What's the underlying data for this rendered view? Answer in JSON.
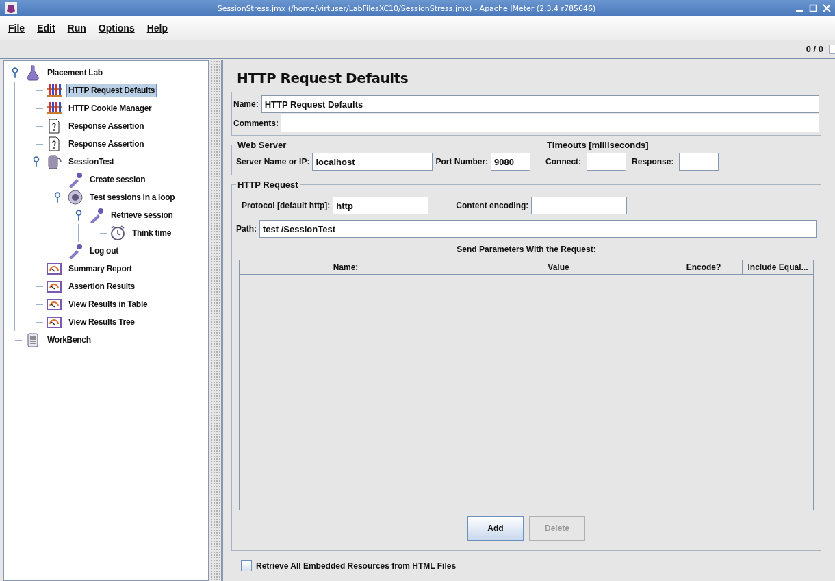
{
  "window": {
    "title": "SessionStress.jmx (/home/virtuser/LabFilesXC10/SessionStress.jmx) - Apache JMeter (2.3.4 r785646)"
  },
  "menu": [
    {
      "label": "File"
    },
    {
      "label": "Edit"
    },
    {
      "label": "Run"
    },
    {
      "label": "Options"
    },
    {
      "label": "Help"
    }
  ],
  "toolbar": {
    "counter": "0 / 0"
  },
  "tree": [
    {
      "label": "Placement Lab",
      "kind": "test_plan",
      "selected": false,
      "expanded": true,
      "children": [
        {
          "label": "HTTP Request Defaults",
          "kind": "config",
          "selected": true
        },
        {
          "label": "HTTP Cookie Manager",
          "kind": "config",
          "selected": false
        },
        {
          "label": "Response Assertion",
          "kind": "assertion",
          "selected": false
        },
        {
          "label": "Response Assertion",
          "kind": "assertion",
          "selected": false
        },
        {
          "label": "SessionTest",
          "kind": "thread_group",
          "selected": false,
          "expanded": true,
          "children": [
            {
              "label": "Create session",
              "kind": "sampler",
              "selected": false
            },
            {
              "label": "Test sessions in a loop",
              "kind": "loop",
              "selected": false,
              "expanded": true,
              "children": [
                {
                  "label": "Retrieve session",
                  "kind": "sampler",
                  "selected": false,
                  "expanded": true,
                  "children": [
                    {
                      "label": "Think time",
                      "kind": "timer",
                      "selected": false
                    }
                  ]
                }
              ]
            },
            {
              "label": "Log out",
              "kind": "sampler",
              "selected": false
            }
          ]
        },
        {
          "label": "Summary Report",
          "kind": "listener",
          "selected": false
        },
        {
          "label": "Assertion Results",
          "kind": "listener",
          "selected": false
        },
        {
          "label": "View Results in Table",
          "kind": "listener",
          "selected": false
        },
        {
          "label": "View Results Tree",
          "kind": "listener",
          "selected": false
        }
      ]
    },
    {
      "label": "WorkBench",
      "kind": "workbench",
      "selected": false
    }
  ],
  "panel": {
    "heading": "HTTP Request Defaults",
    "name": {
      "label": "Name:",
      "value": "HTTP Request Defaults"
    },
    "comments": {
      "label": "Comments:"
    },
    "web_server": {
      "title": "Web Server",
      "fields": [
        {
          "label": "Server Name or IP:",
          "value": "localhost"
        },
        {
          "label": "Port Number:",
          "value": "9080"
        }
      ]
    },
    "timeouts": {
      "title": "Timeouts [milliseconds]",
      "fields": [
        {
          "label": "Connect:"
        },
        {
          "label": "Response:"
        }
      ]
    },
    "http_request": {
      "title": "HTTP Request",
      "protocol": {
        "label": "Protocol [default http]:",
        "value": "http"
      },
      "content_encoding": {
        "label": "Content encoding:"
      },
      "path": {
        "label": "Path:",
        "value": "test /SessionTest"
      },
      "parameters": {
        "title": "Send Parameters With the Request:",
        "columns": [
          "Name:",
          "Value",
          "Encode?",
          "Include Equal..."
        ]
      },
      "buttons": [
        {
          "label": "Add",
          "disabled": false
        },
        {
          "label": "Delete",
          "disabled": true
        }
      ]
    },
    "embedded": {
      "label": "Retrieve All Embedded Resources from HTML Files",
      "checked": false
    }
  }
}
